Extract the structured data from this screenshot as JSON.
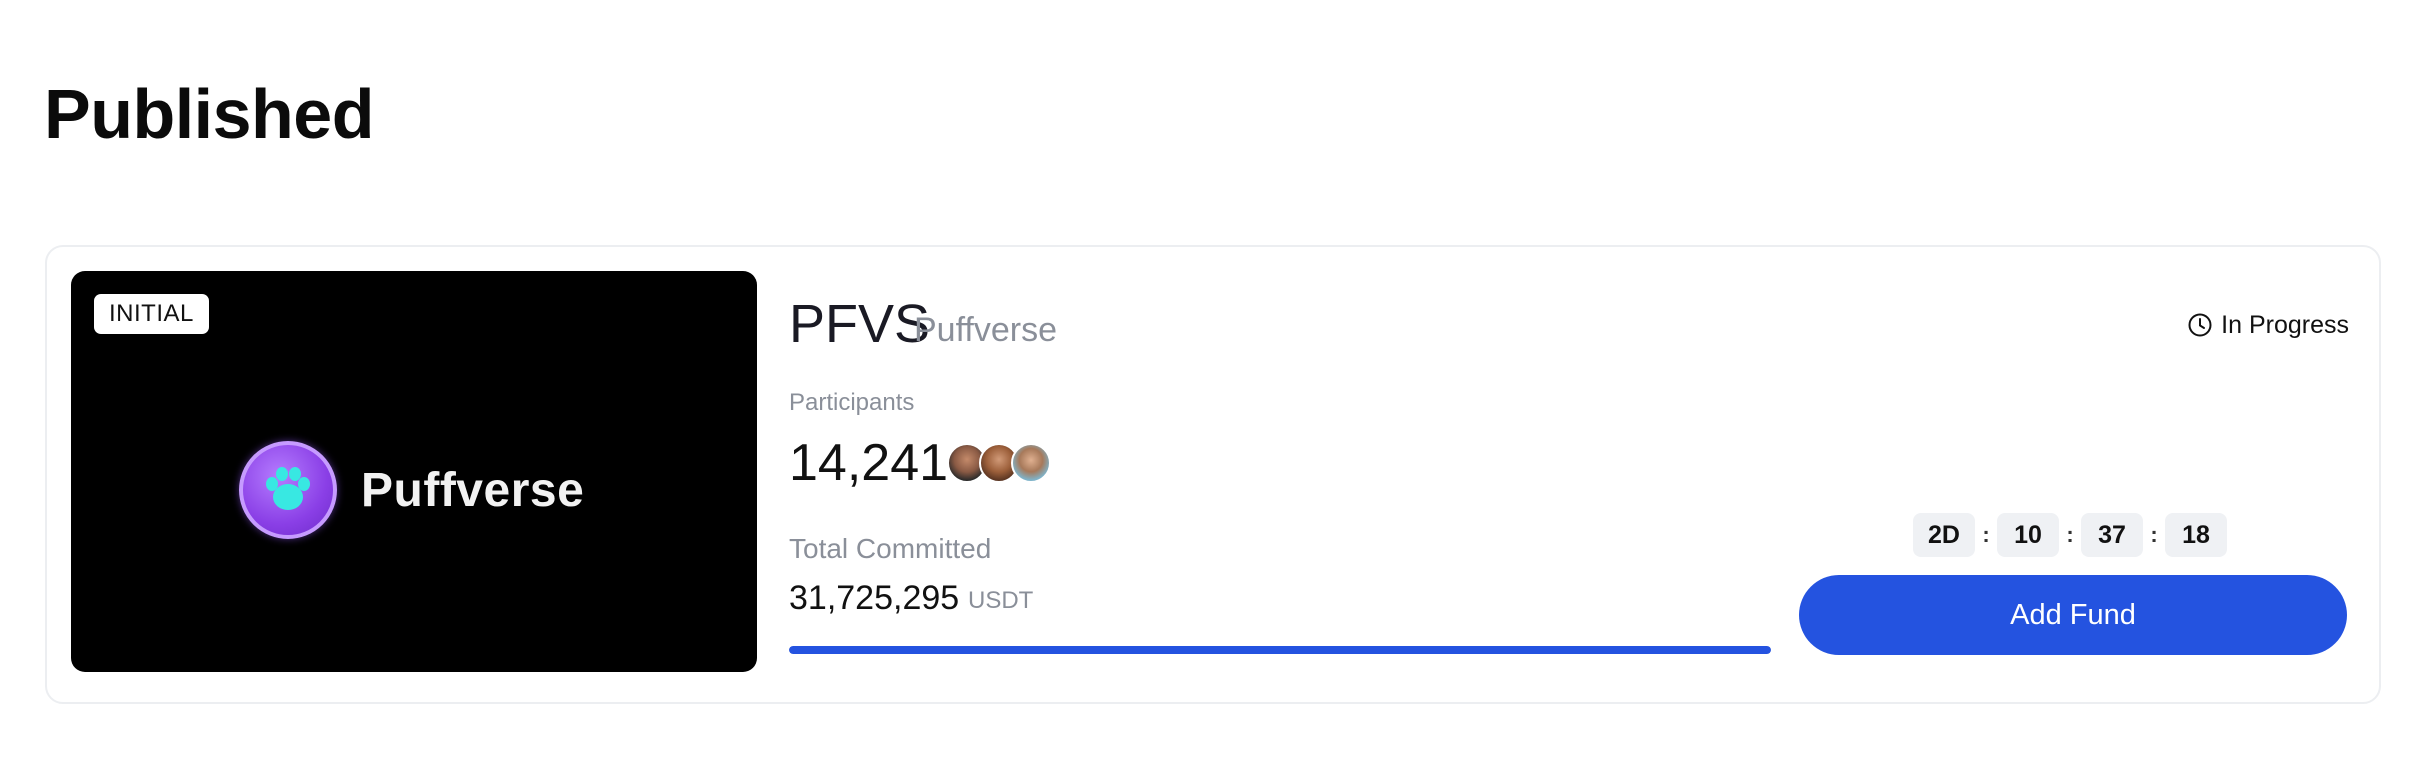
{
  "page": {
    "section_title": "Published"
  },
  "project": {
    "badge": "INITIAL",
    "banner_brand": "Puffverse",
    "ticker": "PFVS",
    "name": "Puffverse",
    "status": "In Progress",
    "participants_label": "Participants",
    "participants_count": "14,241",
    "committed_label": "Total Committed",
    "committed_value": "31,725,295",
    "committed_unit": "USDT",
    "progress_fraction": 1.0
  },
  "countdown": {
    "days": "2D",
    "hours": "10",
    "minutes": "37",
    "seconds": "18",
    "separator": ":"
  },
  "actions": {
    "add_fund_label": "Add Fund"
  },
  "colors": {
    "accent": "#2453e0",
    "banner_bg": "#000000",
    "logo_purple": "#8a3fe6",
    "logo_paw": "#38e8e2",
    "muted_text": "#8a8f99"
  },
  "icons": {
    "status": "clock-icon",
    "logo": "paw-icon"
  }
}
